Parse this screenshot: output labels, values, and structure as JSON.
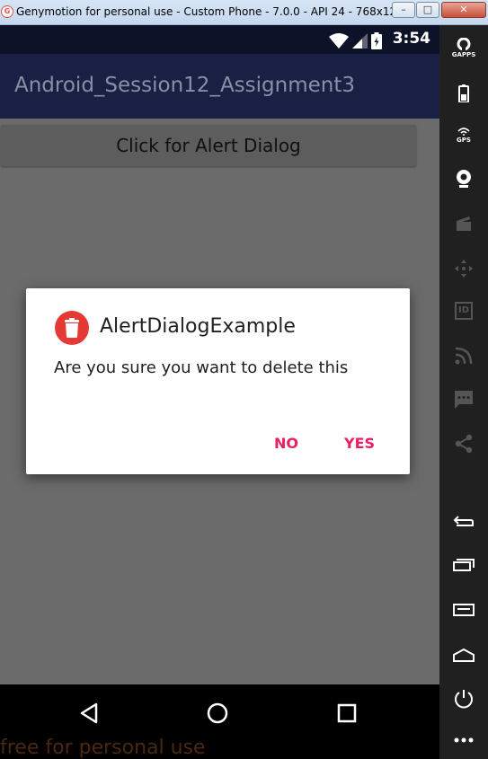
{
  "window": {
    "app_icon_text": "G",
    "title": "Genymotion for personal use - Custom Phone - 7.0.0 - API 24 - 768x1280 (76...",
    "min_label": "–",
    "max_label": "□",
    "close_label": "✕"
  },
  "status_bar": {
    "time": "3:54"
  },
  "app_bar": {
    "title": "Android_Session12_Assignment3"
  },
  "main": {
    "button_label": "Click for Alert Dialog"
  },
  "dialog": {
    "title": "AlertDialogExample",
    "message": "Are you sure you want to delete this",
    "negative_label": "NO",
    "positive_label": "YES",
    "icon": "trash-icon",
    "accent_color": "#e91e63",
    "icon_color": "#e53935"
  },
  "nav_bar": {
    "icons": [
      "back-icon",
      "home-icon",
      "recents-icon"
    ]
  },
  "watermark": "free for personal use",
  "sidebar": {
    "gapps_label": "GAPPS",
    "gps_label": "GPS",
    "id_label": "ID"
  }
}
